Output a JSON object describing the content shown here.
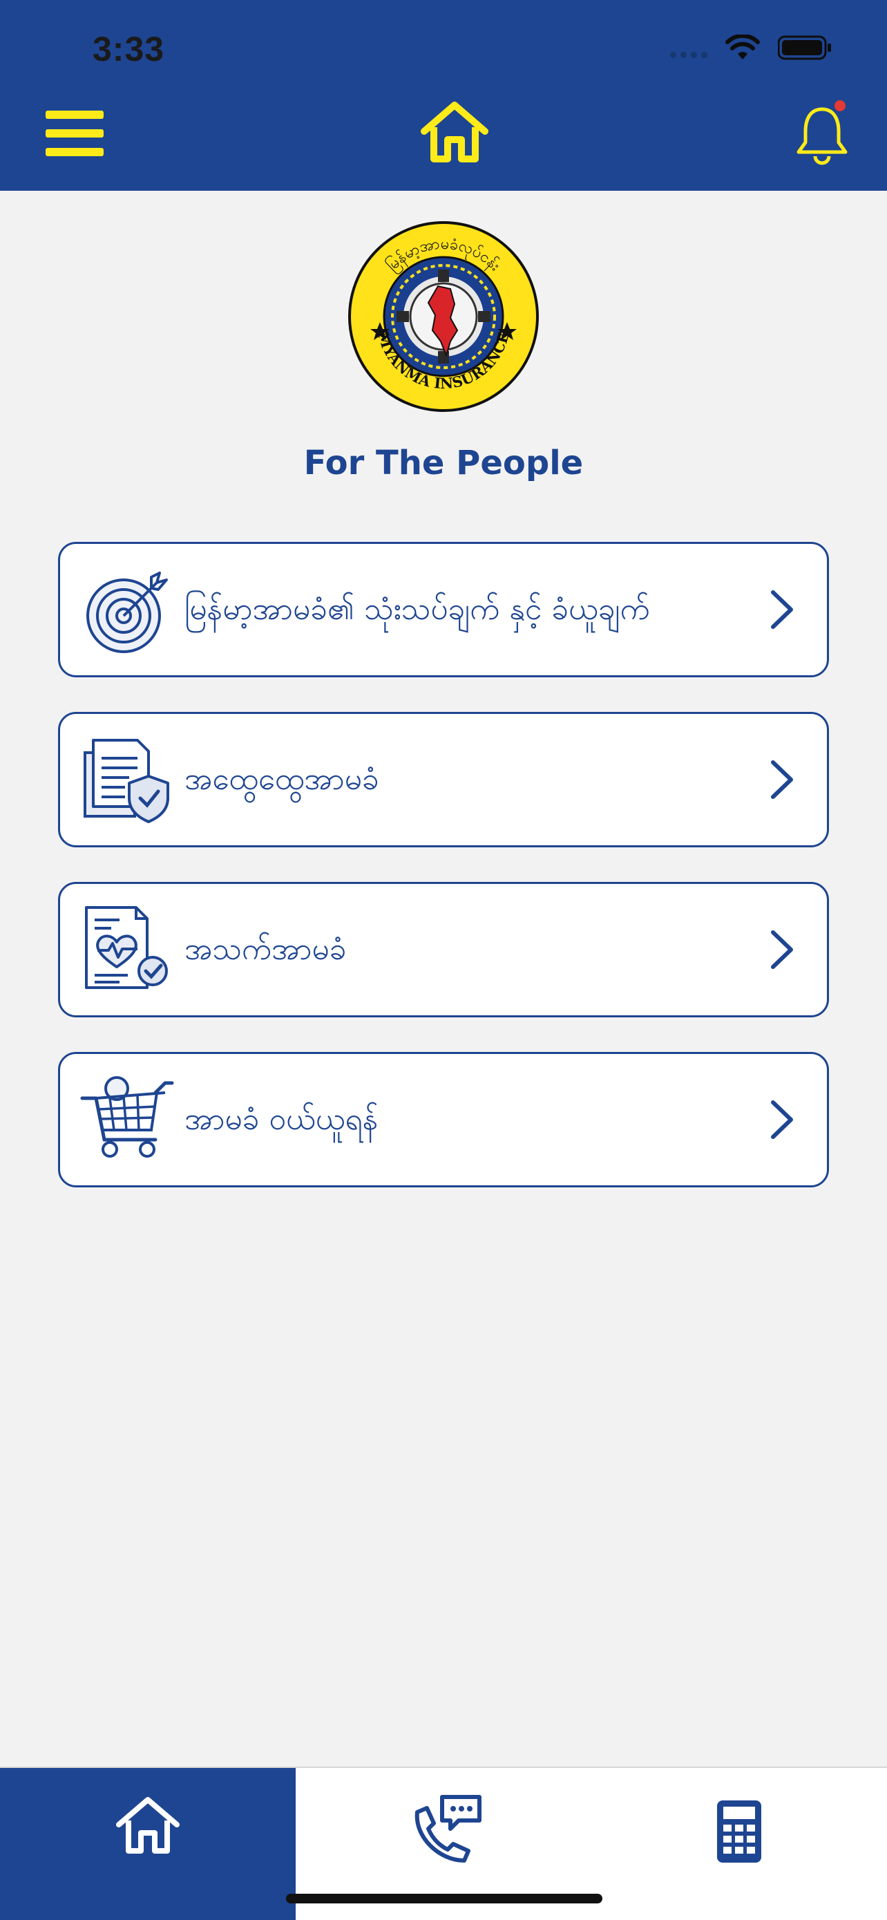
{
  "status_bar": {
    "time": "3:33"
  },
  "header": {
    "menu_icon": "hamburger-menu-icon",
    "home_icon": "home-icon",
    "notification_icon": "bell-icon",
    "accent_color": "#ffeb1a",
    "background_color": "#1e4591",
    "notification_dot_color": "#e53935"
  },
  "brand": {
    "logo": "myanma-insurance-logo",
    "logo_top_text": "မြန်မာ့အာမခံလုပ်ငန်း",
    "logo_bottom_text": "MYANMA INSURANCE",
    "tagline": "For The People"
  },
  "menu": {
    "items": [
      {
        "label": "မြန်မာ့အာမခံ၏ သုံးသပ်ချက် နှင့် ခံယူချက်",
        "icon": "target-icon"
      },
      {
        "label": "အထွေထွေအာမခံ",
        "icon": "document-shield-icon"
      },
      {
        "label": "အသက်အာမခံ",
        "icon": "health-document-icon"
      },
      {
        "label": "အာမခံ ဝယ်ယူရန်",
        "icon": "shopping-cart-icon"
      }
    ]
  },
  "bottom_nav": {
    "items": [
      {
        "icon": "home-icon",
        "active": true
      },
      {
        "icon": "phone-chat-icon",
        "active": false
      },
      {
        "icon": "calculator-icon",
        "active": false
      }
    ]
  }
}
